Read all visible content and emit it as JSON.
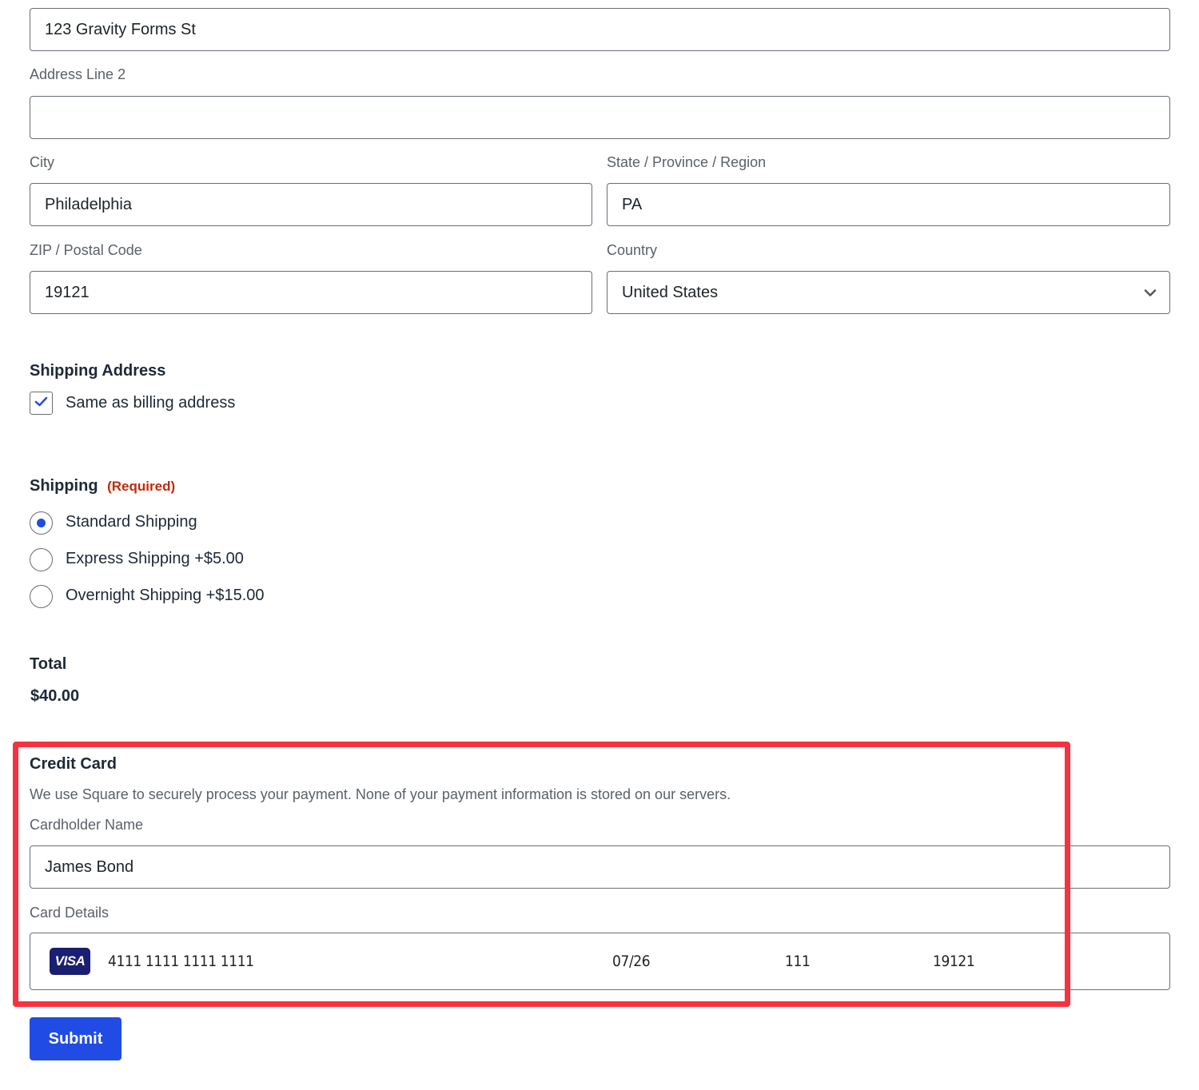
{
  "billing_address": {
    "address_line_1": {
      "value": "123 Gravity Forms St"
    },
    "address_line_2": {
      "label": "Address Line 2",
      "value": ""
    },
    "city": {
      "label": "City",
      "value": "Philadelphia"
    },
    "state": {
      "label": "State / Province / Region",
      "value": "PA"
    },
    "zip": {
      "label": "ZIP / Postal Code",
      "value": "19121"
    },
    "country": {
      "label": "Country",
      "value": "United States",
      "icon": "chevron-down-icon"
    }
  },
  "shipping_address": {
    "heading": "Shipping Address",
    "same_as_billing": {
      "label": "Same as billing address",
      "checked": true
    }
  },
  "shipping": {
    "heading": "Shipping",
    "required_label": "(Required)",
    "options": [
      {
        "label": "Standard Shipping",
        "selected": true
      },
      {
        "label": "Express Shipping +$5.00",
        "selected": false
      },
      {
        "label": "Overnight Shipping +$15.00",
        "selected": false
      }
    ]
  },
  "total": {
    "heading": "Total",
    "value": "$40.00"
  },
  "credit_card": {
    "heading": "Credit Card",
    "description": "We use Square to securely process your payment. None of your payment information is stored on our servers.",
    "cardholder_name": {
      "label": "Cardholder Name",
      "value": "James Bond"
    },
    "card_details": {
      "label": "Card Details",
      "brand": "VISA",
      "number": "4111 1111 1111 1111",
      "expiry": "07/26",
      "cvv": "111",
      "postal_code": "19121"
    }
  },
  "submit": {
    "label": "Submit"
  },
  "colors": {
    "accent": "#204ce5",
    "required": "#c02b0a",
    "annotation": "#f7313f",
    "visa_brand": "#1a1f71"
  }
}
